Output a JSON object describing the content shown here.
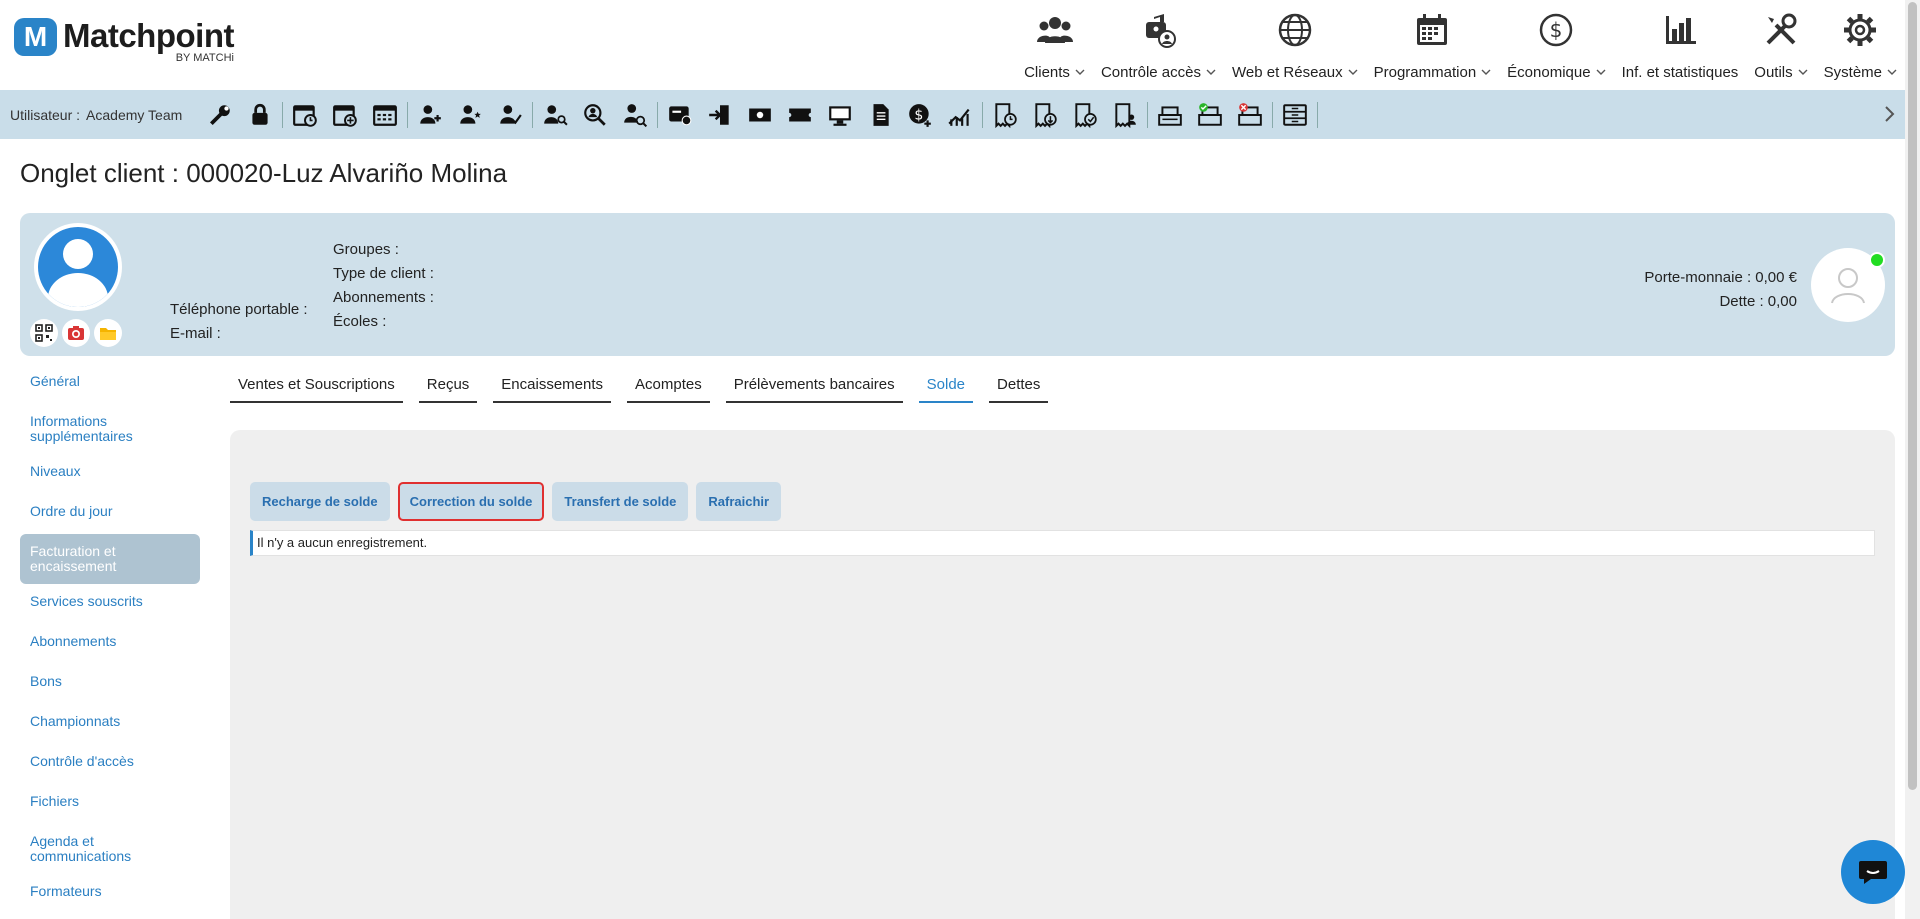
{
  "brand": {
    "logo_letter": "M",
    "name": "Matchpoint",
    "sub": "BY MATCHi",
    "color": "#2a84c8"
  },
  "topnav": [
    {
      "label": "Clients",
      "icon": "people-icon",
      "dropdown": true
    },
    {
      "label": "Contrôle accès",
      "icon": "access-lock-icon",
      "dropdown": true
    },
    {
      "label": "Web et Réseaux",
      "icon": "globe-icon",
      "dropdown": true
    },
    {
      "label": "Programmation",
      "icon": "calendar-icon",
      "dropdown": true
    },
    {
      "label": "Économique",
      "icon": "dollar-circle-icon",
      "dropdown": true
    },
    {
      "label": "Inf. et statistiques",
      "icon": "bar-chart-icon",
      "dropdown": false
    },
    {
      "label": "Outils",
      "icon": "tools-icon",
      "dropdown": true
    },
    {
      "label": "Système",
      "icon": "gear-icon",
      "dropdown": true
    }
  ],
  "toolbar": {
    "user_label": "Utilisateur :",
    "user_name": "Academy Team",
    "icons": [
      "wrench-icon",
      "lock-icon",
      "calendar-clock-icon",
      "calendar-add-icon",
      "calendar-grid-icon",
      "user-add-icon",
      "user-star-icon",
      "user-check-icon",
      "user-search-icon",
      "search-person-icon",
      "user-search-alt-icon",
      "invoice-card-icon",
      "door-enter-icon",
      "cash-icon",
      "ticket-icon",
      "monitor-icon",
      "document-icon",
      "coin-add-icon",
      "growth-chart-icon",
      "receipt-clock-icon",
      "receipt-down-icon",
      "receipt-check-icon",
      "receipt-user-icon",
      "register-icon",
      "register-open-icon",
      "register-close-icon",
      "drawer-icon"
    ],
    "groups": [
      2,
      3,
      3,
      3,
      8,
      4,
      3,
      1
    ]
  },
  "page": {
    "title": "Onglet client : 000020-Luz Alvariño Molina"
  },
  "client": {
    "phone_label": "Téléphone portable :",
    "email_label": "E-mail :",
    "groups_label": "Groupes :",
    "client_type_label": "Type de client :",
    "subscriptions_label": "Abonnements :",
    "schools_label": "Écoles :",
    "wallet": "Porte-monnaie : 0,00 €",
    "debt": "Dette : 0,00",
    "status_color": "#22dd22"
  },
  "sidebar": {
    "items": [
      {
        "label": "Général"
      },
      {
        "label": "Informations supplémentaires"
      },
      {
        "label": "Niveaux"
      },
      {
        "label": "Ordre du jour"
      },
      {
        "label": "Facturation et encaissement",
        "active": true
      },
      {
        "label": "Services souscrits"
      },
      {
        "label": "Abonnements"
      },
      {
        "label": "Bons"
      },
      {
        "label": "Championnats"
      },
      {
        "label": "Contrôle d'accès"
      },
      {
        "label": "Fichiers"
      },
      {
        "label": "Agenda et communications"
      },
      {
        "label": "Formateurs"
      }
    ]
  },
  "tabs": [
    {
      "label": "Ventes et Souscriptions"
    },
    {
      "label": "Reçus"
    },
    {
      "label": "Encaissements"
    },
    {
      "label": "Acomptes"
    },
    {
      "label": "Prélèvements bancaires"
    },
    {
      "label": "Solde",
      "active": true
    },
    {
      "label": "Dettes"
    }
  ],
  "actions": [
    {
      "label": "Recharge de solde"
    },
    {
      "label": "Correction du solde",
      "highlight": true
    },
    {
      "label": "Transfert de solde"
    },
    {
      "label": "Rafraichir"
    }
  ],
  "empty_message": "Il n'y a aucun enregistrement."
}
